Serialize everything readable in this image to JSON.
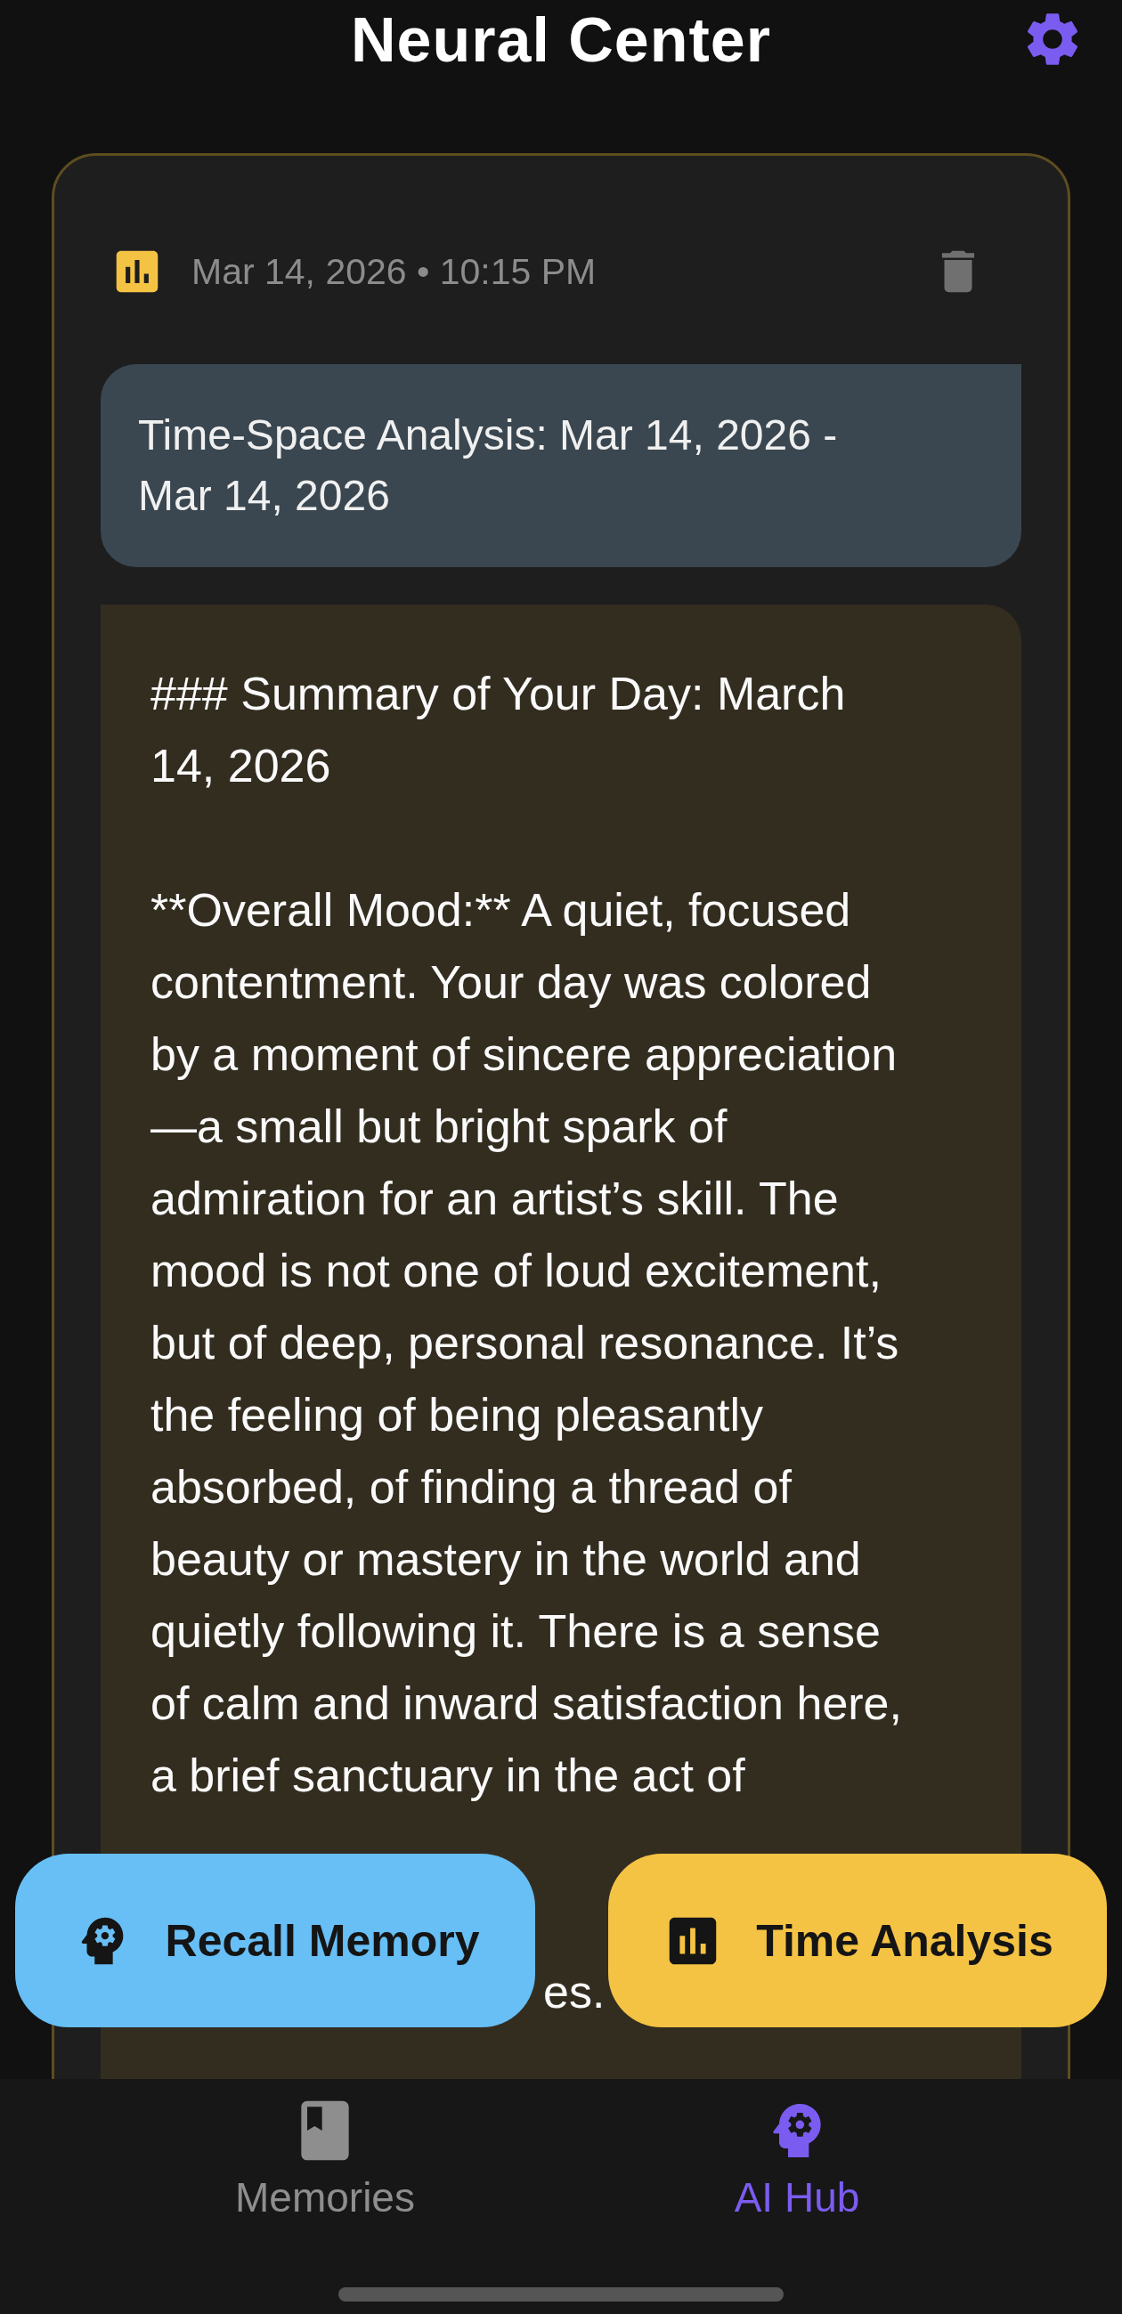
{
  "header": {
    "title": "Neural Center"
  },
  "entry": {
    "timestamp": "Mar 14, 2026 • 10:15 PM",
    "query": "Time-Space Analysis: Mar 14, 2026 - Mar 14, 2026",
    "response_lines": [
      {
        "kind": "text",
        "text": "### Summary of Your Day: March"
      },
      {
        "kind": "text",
        "text": "14, 2026"
      },
      {
        "kind": "blank"
      },
      {
        "kind": "text",
        "text": "**Overall Mood:** A quiet, focused"
      },
      {
        "kind": "text",
        "text": "contentment. Your day was colored"
      },
      {
        "kind": "text",
        "text": "by a moment of sincere appreciation"
      },
      {
        "kind": "text",
        "text": "—a small but bright spark of"
      },
      {
        "kind": "text",
        "text": "admiration for an artist’s skill. The"
      },
      {
        "kind": "text",
        "text": "mood is not one of loud excitement,"
      },
      {
        "kind": "text",
        "text": "but of deep, personal resonance. It’s"
      },
      {
        "kind": "text",
        "text": "the feeling of being pleasantly"
      },
      {
        "kind": "text",
        "text": "absorbed, of finding a thread of"
      },
      {
        "kind": "text",
        "text": "beauty or mastery in the world and"
      },
      {
        "kind": "text",
        "text": "quietly following it. There is a sense"
      },
      {
        "kind": "text",
        "text": "of calm and inward satisfaction here,"
      },
      {
        "kind": "text",
        "text": "a brief sanctuary in the act of"
      },
      {
        "kind": "blank"
      },
      {
        "kind": "blank"
      },
      {
        "kind": "fragment",
        "text": "es."
      }
    ]
  },
  "actions": [
    {
      "kind": "recall",
      "label": "Recall Memory"
    },
    {
      "kind": "analysis",
      "label": "Time Analysis"
    }
  ],
  "nav": [
    {
      "kind": "memories",
      "label": "Memories",
      "selected": false
    },
    {
      "kind": "hub",
      "label": "AI Hub",
      "selected": true
    }
  ]
}
